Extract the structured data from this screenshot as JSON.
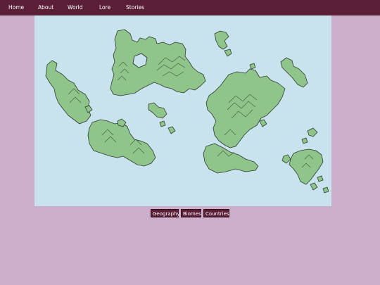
{
  "nav": {
    "items": [
      {
        "label": "Home"
      },
      {
        "label": "About"
      },
      {
        "label": "World"
      },
      {
        "label": "Lore"
      },
      {
        "label": "Stories"
      }
    ]
  },
  "map": {
    "ocean_color": "#c8e3ee",
    "land_color": "#8fc48b",
    "outline_color": "#2f3d2e"
  },
  "tabs": [
    {
      "label": "Geography"
    },
    {
      "label": "Biomes"
    },
    {
      "label": "Countries"
    }
  ],
  "colors": {
    "page_background": "#cbafca",
    "nav_background": "#5a1e36",
    "tab_background": "#5a1e36",
    "text": "#ffffff"
  }
}
